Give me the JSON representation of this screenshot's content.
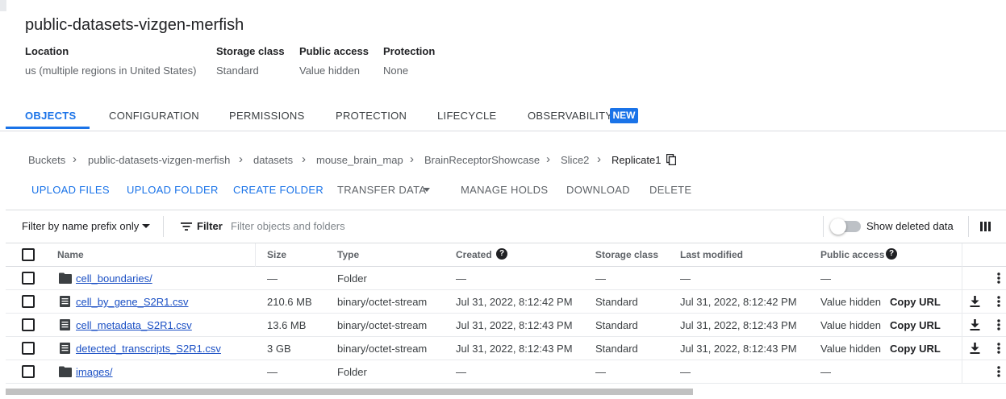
{
  "bucket": {
    "title": "public-datasets-vizgen-merfish",
    "meta": [
      {
        "key": "Location",
        "value": "us (multiple regions in United States)"
      },
      {
        "key": "Storage class",
        "value": "Standard"
      },
      {
        "key": "Public access",
        "value": "Value hidden"
      },
      {
        "key": "Protection",
        "value": "None"
      }
    ]
  },
  "tabs": [
    {
      "label": "OBJECTS",
      "active": true
    },
    {
      "label": "CONFIGURATION"
    },
    {
      "label": "PERMISSIONS"
    },
    {
      "label": "PROTECTION"
    },
    {
      "label": "LIFECYCLE"
    },
    {
      "label": "OBSERVABILITY"
    }
  ],
  "new_badge": "NEW",
  "breadcrumb": [
    "Buckets",
    "public-datasets-vizgen-merfish",
    "datasets",
    "mouse_brain_map",
    "BrainReceptorShowcase",
    "Slice2",
    "Replicate1"
  ],
  "breadcrumb_sep": "›",
  "actions": {
    "upload_files": "UPLOAD FILES",
    "upload_folder": "UPLOAD FOLDER",
    "create_folder": "CREATE FOLDER",
    "transfer_data": "TRANSFER DATA",
    "manage_holds": "MANAGE HOLDS",
    "download": "DOWNLOAD",
    "delete": "DELETE"
  },
  "filter": {
    "prefix_select": "Filter by name prefix only",
    "label": "Filter",
    "placeholder": "Filter objects and folders",
    "show_deleted_label": "Show deleted data",
    "show_deleted_on": false
  },
  "table": {
    "headers": {
      "name": "Name",
      "size": "Size",
      "type": "Type",
      "created": "Created",
      "storage_class": "Storage class",
      "last_modified": "Last modified",
      "public_access": "Public access"
    },
    "rows": [
      {
        "kind": "folder",
        "name": "cell_boundaries/",
        "size": "—",
        "type": "Folder",
        "created": "—",
        "storage_class": "—",
        "last_modified": "—",
        "public_access": "—",
        "copy_url": ""
      },
      {
        "kind": "file",
        "name": "cell_by_gene_S2R1.csv",
        "size": "210.6 MB",
        "type": "binary/octet-stream",
        "created": "Jul 31, 2022, 8:12:42 PM",
        "storage_class": "Standard",
        "last_modified": "Jul 31, 2022, 8:12:42 PM",
        "public_access": "Value hidden",
        "copy_url": "Copy URL"
      },
      {
        "kind": "file",
        "name": "cell_metadata_S2R1.csv",
        "size": "13.6 MB",
        "type": "binary/octet-stream",
        "created": "Jul 31, 2022, 8:12:43 PM",
        "storage_class": "Standard",
        "last_modified": "Jul 31, 2022, 8:12:43 PM",
        "public_access": "Value hidden",
        "copy_url": "Copy URL"
      },
      {
        "kind": "file",
        "name": "detected_transcripts_S2R1.csv",
        "size": "3 GB",
        "type": "binary/octet-stream",
        "created": "Jul 31, 2022, 8:12:43 PM",
        "storage_class": "Standard",
        "last_modified": "Jul 31, 2022, 8:12:43 PM",
        "public_access": "Value hidden",
        "copy_url": "Copy URL"
      },
      {
        "kind": "folder",
        "name": "images/",
        "size": "—",
        "type": "Folder",
        "created": "—",
        "storage_class": "—",
        "last_modified": "—",
        "public_access": "—",
        "copy_url": ""
      }
    ]
  },
  "icons": {
    "help": "?",
    "folder": "folder-icon",
    "file": "file-icon",
    "download": "download-icon",
    "more": "more-vert-icon",
    "columns": "column-display-icon",
    "copy": "copy-icon",
    "filter": "filter-list-icon"
  },
  "colors": {
    "accent": "#1a73e8",
    "link": "#1a4fc4"
  }
}
